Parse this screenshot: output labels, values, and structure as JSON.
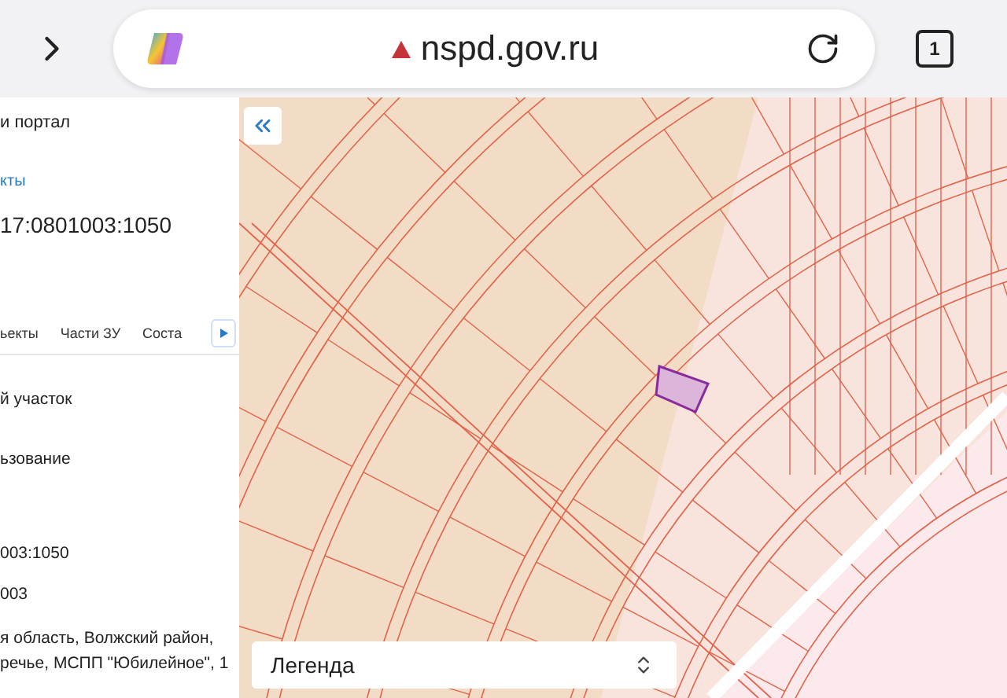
{
  "browser": {
    "url": "nspd.gov.ru",
    "tab_count": "1"
  },
  "panel": {
    "portal": "и портал",
    "link": "кты",
    "cadastral_number": "17:0801003:1050",
    "tabs": [
      {
        "label": "ьекты"
      },
      {
        "label": "Части ЗУ"
      },
      {
        "label": "Соста"
      }
    ],
    "fields": [
      {
        "value": "й участок"
      },
      {
        "value": "ьзование"
      },
      {
        "value": "003:1050"
      },
      {
        "value": "003"
      },
      {
        "value": "я область, Волжский район, речье, МСПП \"Юбилейное\", 1"
      }
    ]
  },
  "map": {
    "legend": "Легенда"
  }
}
